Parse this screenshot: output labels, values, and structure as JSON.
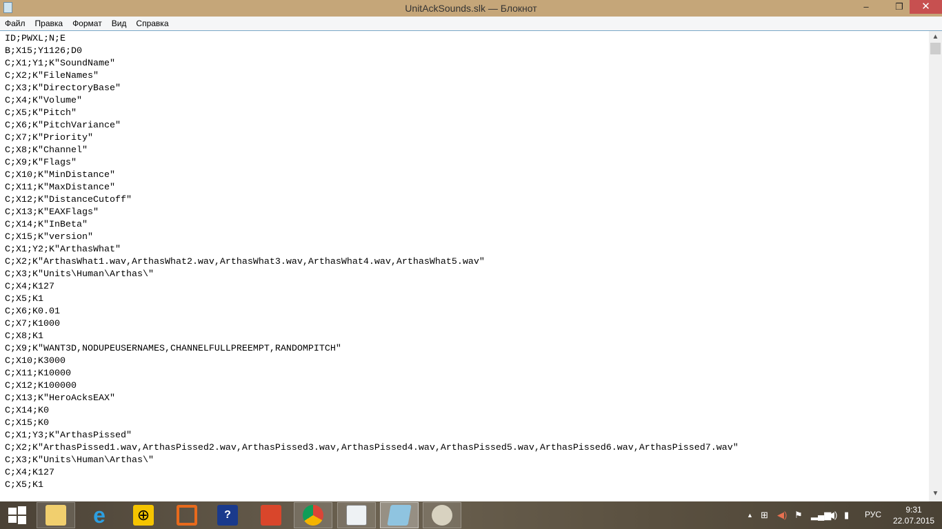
{
  "window": {
    "title": "UnitAckSounds.slk — Блокнот",
    "minimize": "–",
    "restore": "❐",
    "close": "✕"
  },
  "menu": [
    "Файл",
    "Правка",
    "Формат",
    "Вид",
    "Справка"
  ],
  "lines": [
    "ID;PWXL;N;E",
    "B;X15;Y1126;D0",
    "C;X1;Y1;K\"SoundName\"",
    "C;X2;K\"FileNames\"",
    "C;X3;K\"DirectoryBase\"",
    "C;X4;K\"Volume\"",
    "C;X5;K\"Pitch\"",
    "C;X6;K\"PitchVariance\"",
    "C;X7;K\"Priority\"",
    "C;X8;K\"Channel\"",
    "C;X9;K\"Flags\"",
    "C;X10;K\"MinDistance\"",
    "C;X11;K\"MaxDistance\"",
    "C;X12;K\"DistanceCutoff\"",
    "C;X13;K\"EAXFlags\"",
    "C;X14;K\"InBeta\"",
    "C;X15;K\"version\"",
    "C;X1;Y2;K\"ArthasWhat\"",
    "C;X2;K\"ArthasWhat1.wav,ArthasWhat2.wav,ArthasWhat3.wav,ArthasWhat4.wav,ArthasWhat5.wav\"",
    "C;X3;K\"Units\\Human\\Arthas\\\"",
    "C;X4;K127",
    "C;X5;K1",
    "C;X6;K0.01",
    "C;X7;K1000",
    "C;X8;K1",
    "C;X9;K\"WANT3D,NODUPEUSERNAMES,CHANNELFULLPREEMPT,RANDOMPITCH\"",
    "C;X10;K3000",
    "C;X11;K10000",
    "C;X12;K100000",
    "C;X13;K\"HeroAcksEAX\"",
    "C;X14;K0",
    "C;X15;K0",
    "C;X1;Y3;K\"ArthasPissed\"",
    "C;X2;K\"ArthasPissed1.wav,ArthasPissed2.wav,ArthasPissed3.wav,ArthasPissed4.wav,ArthasPissed5.wav,ArthasPissed6.wav,ArthasPissed7.wav\"",
    "C;X3;K\"Units\\Human\\Arthas\\\"",
    "C;X4;K127",
    "C;X5;K1"
  ],
  "tray": {
    "language": "РУС",
    "time": "9:31",
    "date": "22.07.2015"
  }
}
